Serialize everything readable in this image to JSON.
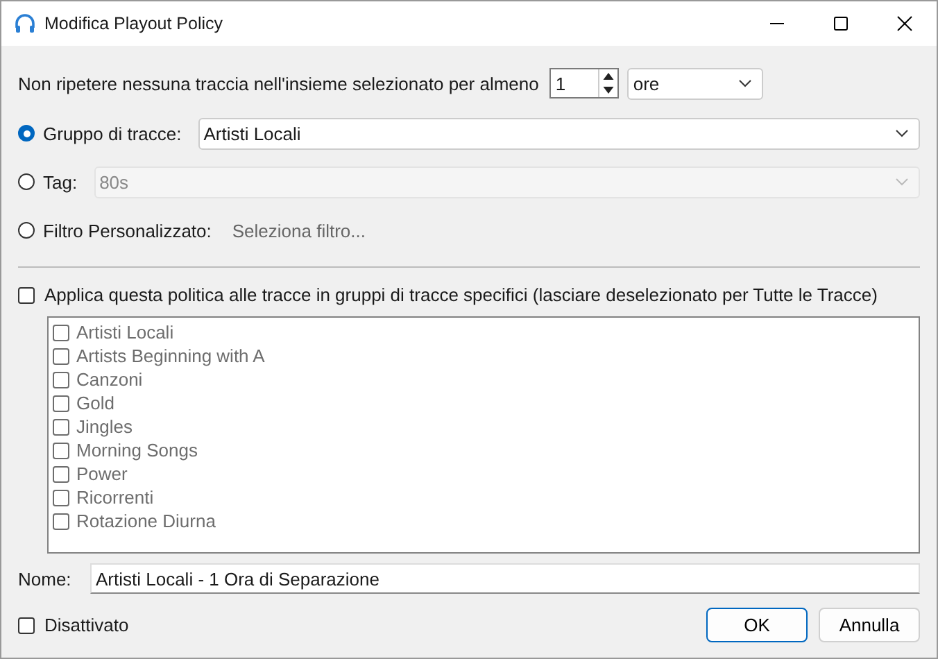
{
  "window": {
    "title": "Modifica Playout Policy"
  },
  "repeat": {
    "label": "Non ripetere nessuna traccia nell'insieme selezionato per almeno",
    "value": "1",
    "unit": "ore"
  },
  "sources": [
    {
      "label": "Gruppo di tracce:",
      "kind": "combo",
      "value": "Artisti Locali",
      "selected": true
    },
    {
      "label": "Tag:",
      "kind": "combo",
      "value": "80s",
      "selected": false,
      "disabled": true
    },
    {
      "label": "Filtro Personalizzato:",
      "kind": "link",
      "value": "Seleziona filtro...",
      "selected": false
    }
  ],
  "apply": {
    "label": "Applica questa politica alle tracce in gruppi di tracce specifici (lasciare deselezionato per Tutte le Tracce)",
    "checked": false
  },
  "groups": [
    {
      "label": "Artisti Locali",
      "checked": false
    },
    {
      "label": "Artists Beginning with A",
      "checked": false
    },
    {
      "label": "Canzoni",
      "checked": false
    },
    {
      "label": "Gold",
      "checked": false
    },
    {
      "label": "Jingles",
      "checked": false
    },
    {
      "label": "Morning Songs",
      "checked": false
    },
    {
      "label": "Power",
      "checked": false
    },
    {
      "label": "Ricorrenti",
      "checked": false
    },
    {
      "label": "Rotazione Diurna",
      "checked": false
    }
  ],
  "groups_disabled": true,
  "name": {
    "label": "Nome:",
    "value": "Artisti Locali - 1 Ora di Separazione"
  },
  "disabled_option": {
    "label": "Disattivato",
    "checked": false
  },
  "buttons": [
    {
      "label": "OK",
      "default": true
    },
    {
      "label": "Annulla",
      "default": false
    }
  ]
}
